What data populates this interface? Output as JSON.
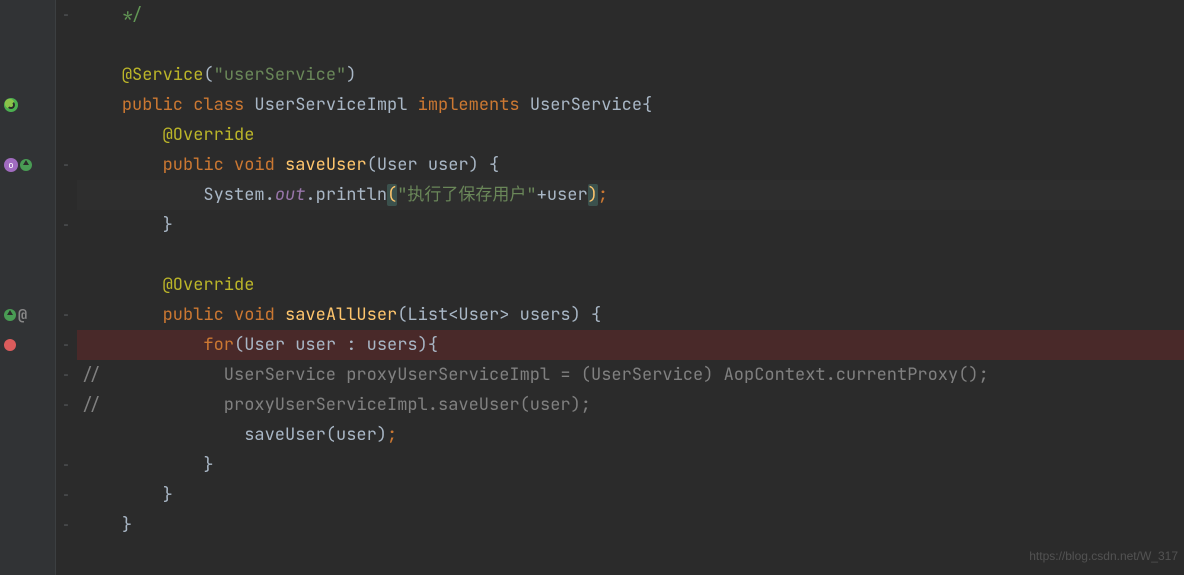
{
  "watermark": "https://blog.csdn.net/W_317",
  "fold_marks": [
    "−",
    "−",
    "−",
    "−",
    "−",
    "−",
    "−",
    "−",
    "−",
    "−"
  ],
  "lines": [
    {
      "indent": "    ",
      "segs": [
        {
          "cls": "c-comment-g",
          "txt": "*/"
        }
      ]
    },
    {
      "indent": "",
      "segs": []
    },
    {
      "indent": "    ",
      "segs": [
        {
          "cls": "c-anno",
          "txt": "@Service"
        },
        {
          "cls": "c-ident",
          "txt": "("
        },
        {
          "cls": "c-string",
          "txt": "\"userService\""
        },
        {
          "cls": "c-ident",
          "txt": ")"
        }
      ]
    },
    {
      "indent": "    ",
      "segs": [
        {
          "cls": "c-kw",
          "txt": "public class "
        },
        {
          "cls": "c-ident",
          "txt": "UserServiceImpl "
        },
        {
          "cls": "c-kw",
          "txt": "implements "
        },
        {
          "cls": "c-ident",
          "txt": "UserService{"
        }
      ]
    },
    {
      "indent": "        ",
      "segs": [
        {
          "cls": "c-anno",
          "txt": "@Override"
        }
      ]
    },
    {
      "indent": "        ",
      "segs": [
        {
          "cls": "c-kw",
          "txt": "public void "
        },
        {
          "cls": "c-method",
          "txt": "saveUser"
        },
        {
          "cls": "c-ident",
          "txt": "(User user) {"
        }
      ]
    },
    {
      "indent": "            ",
      "hl": "cur",
      "segs": [
        {
          "cls": "c-ident",
          "txt": "System."
        },
        {
          "cls": "c-field-i",
          "txt": "out"
        },
        {
          "cls": "c-ident",
          "txt": ".println"
        },
        {
          "cls": "c-paren-hl",
          "txt": "("
        },
        {
          "cls": "c-string",
          "txt": "\"执行了保存用户\""
        },
        {
          "cls": "c-ident",
          "txt": "+user"
        },
        {
          "cls": "c-paren-hl",
          "txt": ")"
        },
        {
          "cls": "c-kw",
          "txt": ";"
        }
      ]
    },
    {
      "indent": "        ",
      "segs": [
        {
          "cls": "c-ident",
          "txt": "}"
        }
      ]
    },
    {
      "indent": "",
      "segs": []
    },
    {
      "indent": "        ",
      "segs": [
        {
          "cls": "c-anno",
          "txt": "@Override"
        }
      ]
    },
    {
      "indent": "        ",
      "segs": [
        {
          "cls": "c-kw",
          "txt": "public void "
        },
        {
          "cls": "c-method",
          "txt": "saveAllUser"
        },
        {
          "cls": "c-ident",
          "txt": "(List<User> users) {"
        }
      ]
    },
    {
      "indent": "            ",
      "hl": "bp",
      "segs": [
        {
          "cls": "c-kw",
          "txt": "for"
        },
        {
          "cls": "c-ident",
          "txt": "(User user : users){"
        }
      ]
    },
    {
      "indent": "",
      "segs": [
        {
          "cls": "c-comment",
          "txt": "//            UserService proxyUserServiceImpl = (UserService) AopContext.currentProxy();"
        }
      ]
    },
    {
      "indent": "",
      "segs": [
        {
          "cls": "c-comment",
          "txt": "//            proxyUserServiceImpl.saveUser(user);"
        }
      ]
    },
    {
      "indent": "                ",
      "segs": [
        {
          "cls": "c-ident",
          "txt": "saveUser(user)"
        },
        {
          "cls": "c-kw",
          "txt": ";"
        }
      ]
    },
    {
      "indent": "            ",
      "segs": [
        {
          "cls": "c-ident",
          "txt": "}"
        }
      ]
    },
    {
      "indent": "        ",
      "segs": [
        {
          "cls": "c-ident",
          "txt": "}"
        }
      ]
    },
    {
      "indent": "    ",
      "segs": [
        {
          "cls": "c-ident",
          "txt": "}"
        }
      ]
    },
    {
      "indent": "",
      "segs": []
    }
  ],
  "gutter": [
    {
      "row": 0,
      "icons": [],
      "fold": "−"
    },
    {
      "row": 3,
      "icons": [
        "spring"
      ]
    },
    {
      "row": 5,
      "icons": [
        "override",
        "impl"
      ],
      "fold": "−"
    },
    {
      "row": 7,
      "fold": "−"
    },
    {
      "row": 10,
      "icons": [
        "impl",
        "at"
      ],
      "fold": "−"
    },
    {
      "row": 11,
      "icons": [
        "bp"
      ],
      "fold": "−"
    },
    {
      "row": 12,
      "fold": "−"
    },
    {
      "row": 13,
      "fold": "−"
    },
    {
      "row": 15,
      "fold": "−"
    },
    {
      "row": 16,
      "fold": "−"
    },
    {
      "row": 17,
      "fold": "−"
    }
  ]
}
